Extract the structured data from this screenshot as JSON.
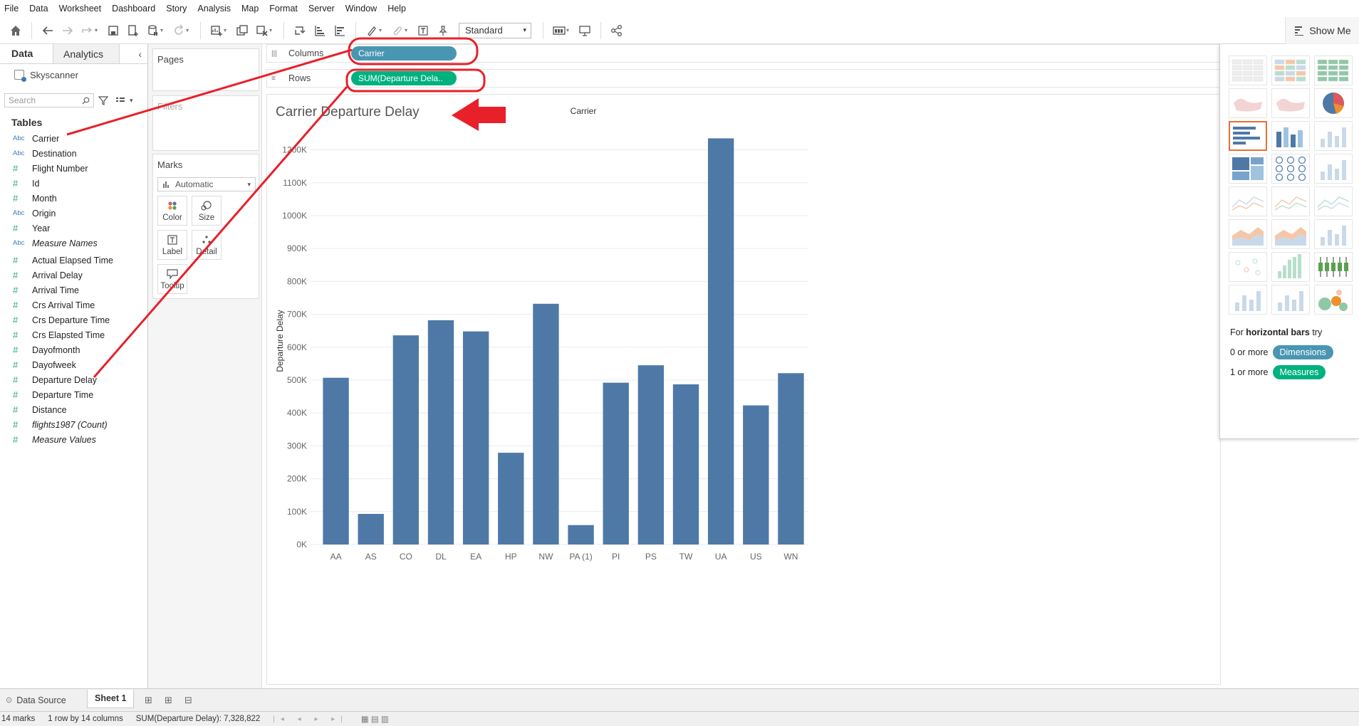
{
  "menu": [
    "File",
    "Data",
    "Worksheet",
    "Dashboard",
    "Story",
    "Analysis",
    "Map",
    "Format",
    "Server",
    "Window",
    "Help"
  ],
  "toolbar": {
    "fit": "Standard",
    "show_me": "Show Me"
  },
  "left": {
    "tab_data": "Data",
    "tab_analytics": "Analytics",
    "source": "Skyscanner",
    "search_placeholder": "Search",
    "tables_heading": "Tables",
    "dimensions": [
      {
        "type": "Abc",
        "label": "Carrier"
      },
      {
        "type": "Abc",
        "label": "Destination"
      },
      {
        "type": "#",
        "label": "Flight Number"
      },
      {
        "type": "#",
        "label": "Id"
      },
      {
        "type": "#",
        "label": "Month"
      },
      {
        "type": "Abc",
        "label": "Origin"
      },
      {
        "type": "#",
        "label": "Year"
      },
      {
        "type": "Abc",
        "label": "Measure Names",
        "italic": true
      }
    ],
    "measures": [
      {
        "type": "#",
        "label": "Actual Elapsed Time"
      },
      {
        "type": "#",
        "label": "Arrival Delay"
      },
      {
        "type": "#",
        "label": "Arrival Time"
      },
      {
        "type": "#",
        "label": "Crs Arrival Time"
      },
      {
        "type": "#",
        "label": "Crs Departure Time"
      },
      {
        "type": "#",
        "label": "Crs Elapsted Time"
      },
      {
        "type": "#",
        "label": "Dayofmonth"
      },
      {
        "type": "#",
        "label": "Dayofweek"
      },
      {
        "type": "#",
        "label": "Departure Delay"
      },
      {
        "type": "#",
        "label": "Departure Time"
      },
      {
        "type": "#",
        "label": "Distance"
      },
      {
        "type": "#",
        "label": "flights1987 (Count)",
        "italic": true
      },
      {
        "type": "#",
        "label": "Measure Values",
        "italic": true
      }
    ]
  },
  "cards": {
    "pages": "Pages",
    "filters": "Filters",
    "marks": "Marks",
    "mark_type": "Automatic",
    "mark_buttons": [
      "Color",
      "Size",
      "Label",
      "Detail",
      "Tooltip"
    ]
  },
  "shelves": {
    "columns_label": "Columns",
    "rows_label": "Rows",
    "columns_pill": "Carrier",
    "rows_pill": "SUM(Departure Dela.."
  },
  "viz": {
    "title": "Carrier Departure Delay"
  },
  "chart_data": {
    "type": "bar",
    "title": "Carrier Departure Delay",
    "xlabel": "Carrier",
    "ylabel": "Departure Delay",
    "categories": [
      "AA",
      "AS",
      "CO",
      "DL",
      "EA",
      "HP",
      "NW",
      "PA (1)",
      "PI",
      "PS",
      "TW",
      "UA",
      "US",
      "WN"
    ],
    "values": [
      507000,
      93000,
      636000,
      682000,
      648000,
      279000,
      732000,
      59000,
      492000,
      545000,
      487000,
      1235000,
      423000,
      521000
    ],
    "yticks": [
      "0K",
      "100K",
      "200K",
      "300K",
      "400K",
      "500K",
      "600K",
      "700K",
      "800K",
      "900K",
      "1000K",
      "1100K",
      "1200K"
    ],
    "ylim": [
      0,
      1200000
    ],
    "color": "#4e79a7",
    "grid": true
  },
  "showme": {
    "hint_prefix": "For",
    "hint_bold": "horizontal bars",
    "hint_suffix": "try",
    "dims_prefix": "0 or more",
    "dims_pill": "Dimensions",
    "meas_prefix": "1 or more",
    "meas_pill": "Measures"
  },
  "sheets": {
    "data_source": "Data Source",
    "sheet1": "Sheet 1"
  },
  "status": {
    "marks": "14 marks",
    "shape": "1 row by 14 columns",
    "sum": "SUM(Departure Delay): 7,328,822"
  },
  "colors": {
    "dimension": "#4996b2",
    "measure": "#00b180",
    "annotation": "#e8202a"
  }
}
